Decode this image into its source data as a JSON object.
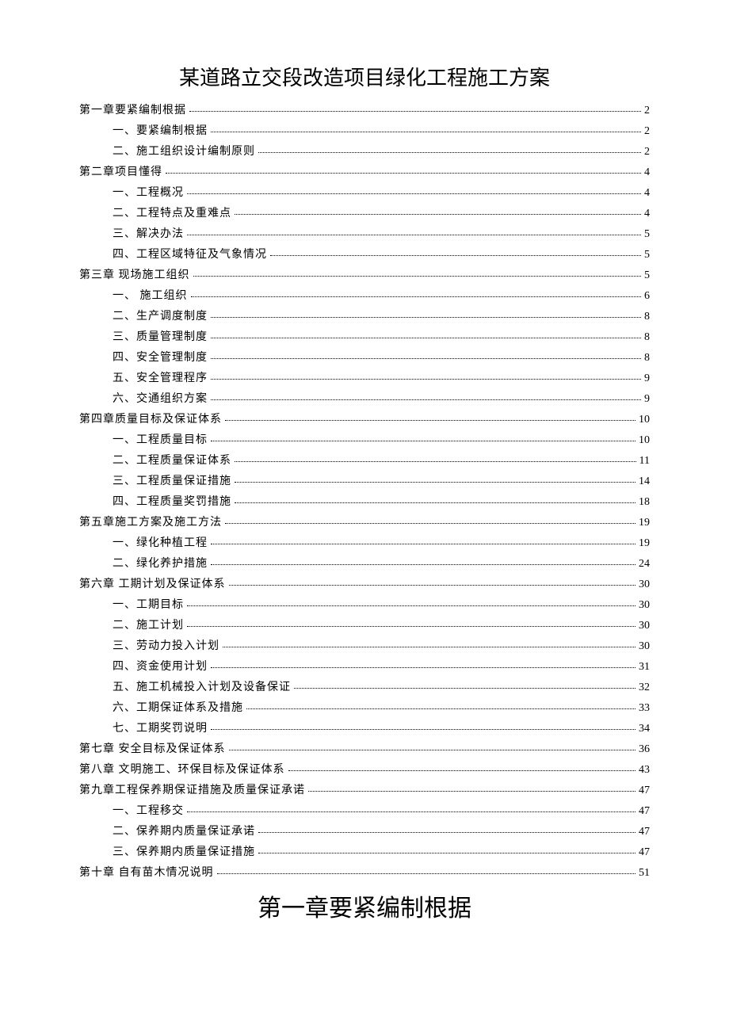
{
  "title": "某道路立交段改造项目绿化工程施工方案",
  "toc": [
    {
      "level": 1,
      "label": "第一章要紧编制根据",
      "page": "2"
    },
    {
      "level": 2,
      "label": "一、要紧编制根据",
      "page": "2"
    },
    {
      "level": 2,
      "label": "二、施工组织设计编制原则",
      "page": "2"
    },
    {
      "level": 1,
      "label": "第二章项目懂得",
      "page": "4"
    },
    {
      "level": 2,
      "label": "一、工程概况",
      "page": "4"
    },
    {
      "level": 2,
      "label": "二、工程特点及重难点",
      "page": "4"
    },
    {
      "level": 2,
      "label": "三、解决办法",
      "page": "5"
    },
    {
      "level": 2,
      "label": "四、工程区域特征及气象情况",
      "page": "5"
    },
    {
      "level": 1,
      "label": "第三章 现场施工组织",
      "page": "5"
    },
    {
      "level": 2,
      "label": "一、 施工组织",
      "page": "6"
    },
    {
      "level": 2,
      "label": "二、生产调度制度",
      "page": "8"
    },
    {
      "level": 2,
      "label": "三、质量管理制度",
      "page": "8"
    },
    {
      "level": 2,
      "label": "四、安全管理制度",
      "page": "8"
    },
    {
      "level": 2,
      "label": "五、安全管理程序",
      "page": "9"
    },
    {
      "level": 2,
      "label": "六、交通组织方案",
      "page": "9"
    },
    {
      "level": 1,
      "label": "第四章质量目标及保证体系",
      "page": "10"
    },
    {
      "level": 2,
      "label": "一、工程质量目标",
      "page": "10"
    },
    {
      "level": 2,
      "label": "二、工程质量保证体系",
      "page": "11"
    },
    {
      "level": 2,
      "label": "三、工程质量保证措施",
      "page": "14"
    },
    {
      "level": 2,
      "label": "四、工程质量奖罚措施",
      "page": "18"
    },
    {
      "level": 1,
      "label": "第五章施工方案及施工方法",
      "page": "19"
    },
    {
      "level": 2,
      "label": "一、绿化种植工程",
      "page": "19"
    },
    {
      "level": 2,
      "label": "二、绿化养护措施",
      "page": "24"
    },
    {
      "level": 1,
      "label": "第六章 工期计划及保证体系",
      "page": "30"
    },
    {
      "level": 2,
      "label": "一、工期目标",
      "page": "30"
    },
    {
      "level": 2,
      "label": "二、施工计划",
      "page": "30"
    },
    {
      "level": 2,
      "label": "三、劳动力投入计划",
      "page": "30"
    },
    {
      "level": 2,
      "label": "四、资金使用计划",
      "page": "31"
    },
    {
      "level": 2,
      "label": "五、施工机械投入计划及设备保证",
      "page": "32"
    },
    {
      "level": 2,
      "label": "六、工期保证体系及措施",
      "page": "33"
    },
    {
      "level": 2,
      "label": "七、工期奖罚说明",
      "page": "34"
    },
    {
      "level": 1,
      "label": "第七章 安全目标及保证体系",
      "page": "36"
    },
    {
      "level": 1,
      "label": "第八章 文明施工、环保目标及保证体系",
      "page": "43"
    },
    {
      "level": 1,
      "label": "第九章工程保养期保证措施及质量保证承诺",
      "page": "47"
    },
    {
      "level": 2,
      "label": "一、工程移交",
      "page": "47"
    },
    {
      "level": 2,
      "label": "二、保养期内质量保证承诺",
      "page": "47"
    },
    {
      "level": 2,
      "label": "三、保养期内质量保证措施",
      "page": "47"
    },
    {
      "level": 1,
      "label": "第十章 自有苗木情况说明",
      "page": "51"
    }
  ],
  "chapter_heading": "第一章要紧编制根据"
}
